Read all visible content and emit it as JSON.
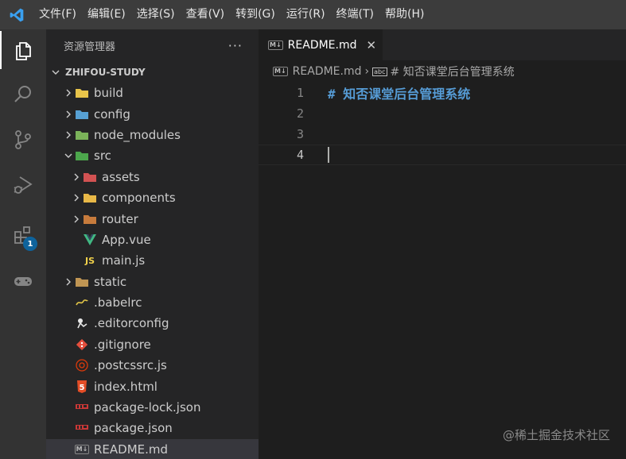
{
  "menubar": {
    "items": [
      "文件(F)",
      "编辑(E)",
      "选择(S)",
      "查看(V)",
      "转到(G)",
      "运行(R)",
      "终端(T)",
      "帮助(H)"
    ]
  },
  "activitybar": {
    "icons": [
      "explorer-icon",
      "search-icon",
      "source-control-icon",
      "run-debug-icon",
      "extensions-icon",
      "remote-gamepad-icon"
    ],
    "extensions_badge": "1"
  },
  "sidebar": {
    "title": "资源管理器",
    "more": "···",
    "root": "ZHIFOU-STUDY",
    "items": [
      {
        "label": "build",
        "icon": "folder-yellow",
        "color": "#e8c44a",
        "chev": true
      },
      {
        "label": "config",
        "icon": "folder-config",
        "color": "#57a0d3",
        "chev": true
      },
      {
        "label": "node_modules",
        "icon": "folder-node",
        "color": "#7bb35a",
        "chev": true
      },
      {
        "label": "src",
        "icon": "folder-src-open",
        "color": "#4ca64c",
        "chev": true,
        "open": true
      },
      {
        "label": "assets",
        "icon": "folder-assets",
        "color": "#d25252",
        "chev": true
      },
      {
        "label": "components",
        "icon": "folder-components",
        "color": "#e8b847",
        "chev": true
      },
      {
        "label": "router",
        "icon": "folder-router",
        "color": "#c77b3c",
        "chev": true
      },
      {
        "label": "App.vue",
        "icon": "vue-icon",
        "color": "#41b883"
      },
      {
        "label": "main.js",
        "icon": "js-icon",
        "color": "#f1d14b",
        "glyph": "JS"
      },
      {
        "label": "static",
        "icon": "folder-plain",
        "color": "#c09553",
        "chev": true
      },
      {
        "label": ".babelrc",
        "icon": "babel-icon",
        "color": "#e2c547"
      },
      {
        "label": ".editorconfig",
        "icon": "editorconfig-icon",
        "color": "#e6e6e6"
      },
      {
        "label": ".gitignore",
        "icon": "git-icon",
        "color": "#e44e3c"
      },
      {
        "label": ".postcssrc.js",
        "icon": "postcss-icon",
        "color": "#dd3a0a"
      },
      {
        "label": "index.html",
        "icon": "html5-icon",
        "color": "#e44d26",
        "glyph": "5"
      },
      {
        "label": "package-lock.json",
        "icon": "npm-icon",
        "color": "#cb3837"
      },
      {
        "label": "package.json",
        "icon": "npm-icon",
        "color": "#cb3837"
      },
      {
        "label": "README.md",
        "icon": "markdown-icon",
        "color": "#9e9e9e",
        "selected": true
      }
    ]
  },
  "editor": {
    "tab_label": "README.md",
    "breadcrumb": {
      "file": "README.md",
      "symbol": "# 知否课堂后台管理系统"
    },
    "lines": [
      {
        "num": "1",
        "text": "# 知否课堂后台管理系统"
      },
      {
        "num": "2",
        "text": ""
      },
      {
        "num": "3",
        "text": ""
      },
      {
        "num": "4",
        "text": ""
      }
    ],
    "current_line": "4"
  },
  "watermark": "@稀土掘金技术社区"
}
